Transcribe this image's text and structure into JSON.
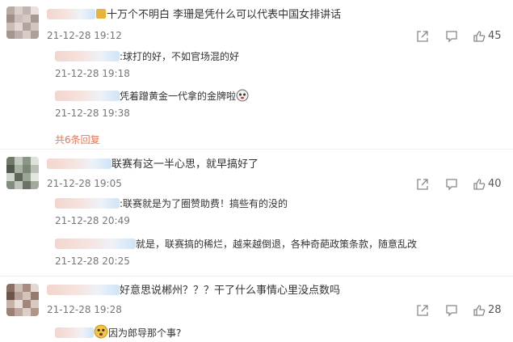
{
  "comments": [
    {
      "text": "十万个不明白 李珊是凭什么可以代表中国女排讲话",
      "time": "21-12-28 19:12",
      "likes": "45",
      "replies": [
        {
          "text": ":球打的好，不如官场混的好",
          "time": "21-12-28 19:18"
        },
        {
          "text": "凭着蹭黄金一代拿的金牌啦",
          "time": "21-12-28 19:38"
        }
      ],
      "more_replies": "共6条回复"
    },
    {
      "text": "联赛有这一半心思，就早搞好了",
      "time": "21-12-28 19:05",
      "likes": "40",
      "replies": [
        {
          "text": ":联赛就是为了圈赞助费！搞些有的没的",
          "time": "21-12-28 20:49"
        },
        {
          "text": "就是，联赛搞的稀烂，越来越倒退，各种奇葩政策条款，随意乱改",
          "time": "21-12-28 20:25"
        }
      ]
    },
    {
      "text": "好意思说郴州？？？干了什么事情心里没点数吗",
      "time": "21-12-28 19:28",
      "likes": "28",
      "replies": [
        {
          "text": "因为郎导那个事?",
          "time": ""
        }
      ]
    }
  ],
  "icons": {
    "share": "share-icon",
    "comment": "comment-icon",
    "like": "thumb-up-icon"
  },
  "colors": {
    "link": "#eb7350",
    "time": "#777777",
    "reply_bg": "#f5f5f5"
  }
}
